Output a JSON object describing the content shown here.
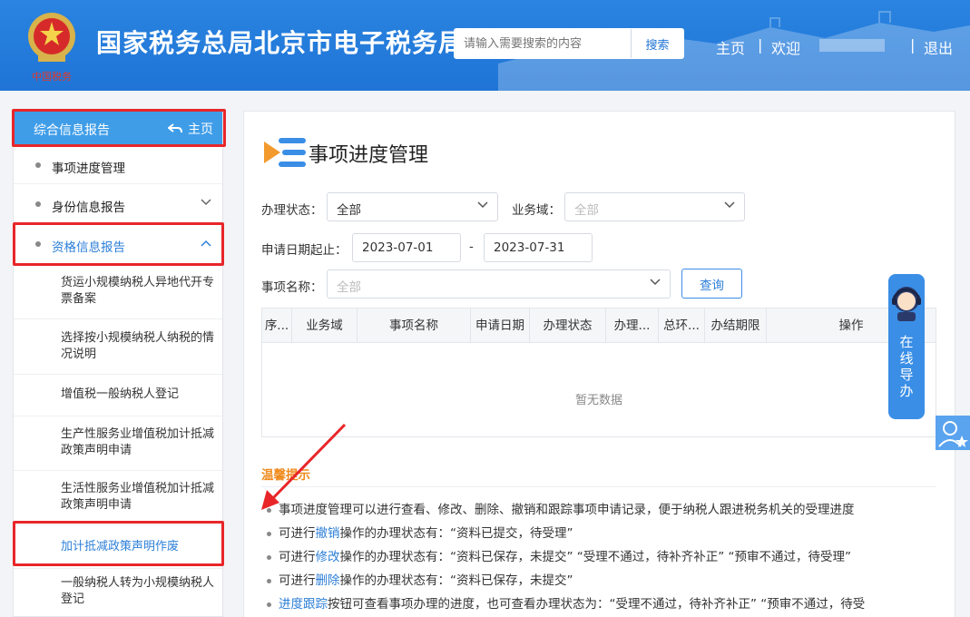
{
  "header": {
    "site_title": "国家税务总局北京市电子税务局",
    "search_placeholder": "请输入需要搜索的内容",
    "search_button": "搜索",
    "nav_home": "主页",
    "nav_separator": "|",
    "nav_welcome": "欢迎",
    "nav_logout": "退出",
    "emblem_caption": "中国税务"
  },
  "sidebar": {
    "header_title": "综合信息报告",
    "home_label": "主页",
    "items": [
      {
        "label": "事项进度管理"
      },
      {
        "label": "身份信息报告"
      },
      {
        "label": "资格信息报告"
      }
    ],
    "sub_items": [
      {
        "label": "货运小规模纳税人异地代开专票备案"
      },
      {
        "label": "选择按小规模纳税人纳税的情况说明"
      },
      {
        "label": "增值税一般纳税人登记"
      },
      {
        "label": "生产性服务业增值税加计抵减政策声明申请"
      },
      {
        "label": "生活性服务业增值税加计抵减政策声明申请"
      },
      {
        "label": "加计抵减政策声明作废"
      },
      {
        "label": "一般纳税人转为小规模纳税人登记"
      }
    ]
  },
  "main": {
    "page_title": "事项进度管理",
    "status_label": "办理状态：",
    "status_value": "全部",
    "domain_label": "业务域：",
    "domain_value": "全部",
    "date_label": "申请日期起止：",
    "date_start": "2023-07-01",
    "date_sep": "-",
    "date_end": "2023-07-31",
    "item_label": "事项名称：",
    "item_value": "全部",
    "query_button": "查询",
    "table_headers": [
      "序...",
      "业务域",
      "事项名称",
      "申请日期",
      "办理状态",
      "办理...",
      "总环...",
      "办结期限",
      "操作"
    ],
    "empty_text": "暂无数据",
    "tips_title": "温馨提示",
    "tips": [
      {
        "pre": "事项进度管理可以进行查看、修改、删除、撤销和跟踪事项申请记录，便于纳税人跟进税务机关的受理进度",
        "link": "",
        "post": ""
      },
      {
        "pre": "可进行",
        "link": "撤销",
        "post": "操作的办理状态有：“资料已提交，待受理”"
      },
      {
        "pre": "可进行",
        "link": "修改",
        "post": "操作的办理状态有：“资料已保存，未提交”  “受理不通过，待补齐补正”  “预审不通过，待受理”"
      },
      {
        "pre": "可进行",
        "link": "删除",
        "post": "操作的办理状态有：“资料已保存，未提交”"
      },
      {
        "pre": "",
        "link": "进度跟踪",
        "post": "按钮可查看事项办理的进度，也可查看办理状态为：“受理不通过，待补齐补正”  “预审不通过，待受"
      }
    ]
  },
  "floating": {
    "guide_text": "在线导办"
  },
  "colors": {
    "header_blue": "#1f74d6",
    "sidebar_active": "#3f9de8",
    "highlight_red": "#e8262a",
    "tip_orange": "#f08a1c",
    "link_blue": "#2d7fd8"
  }
}
